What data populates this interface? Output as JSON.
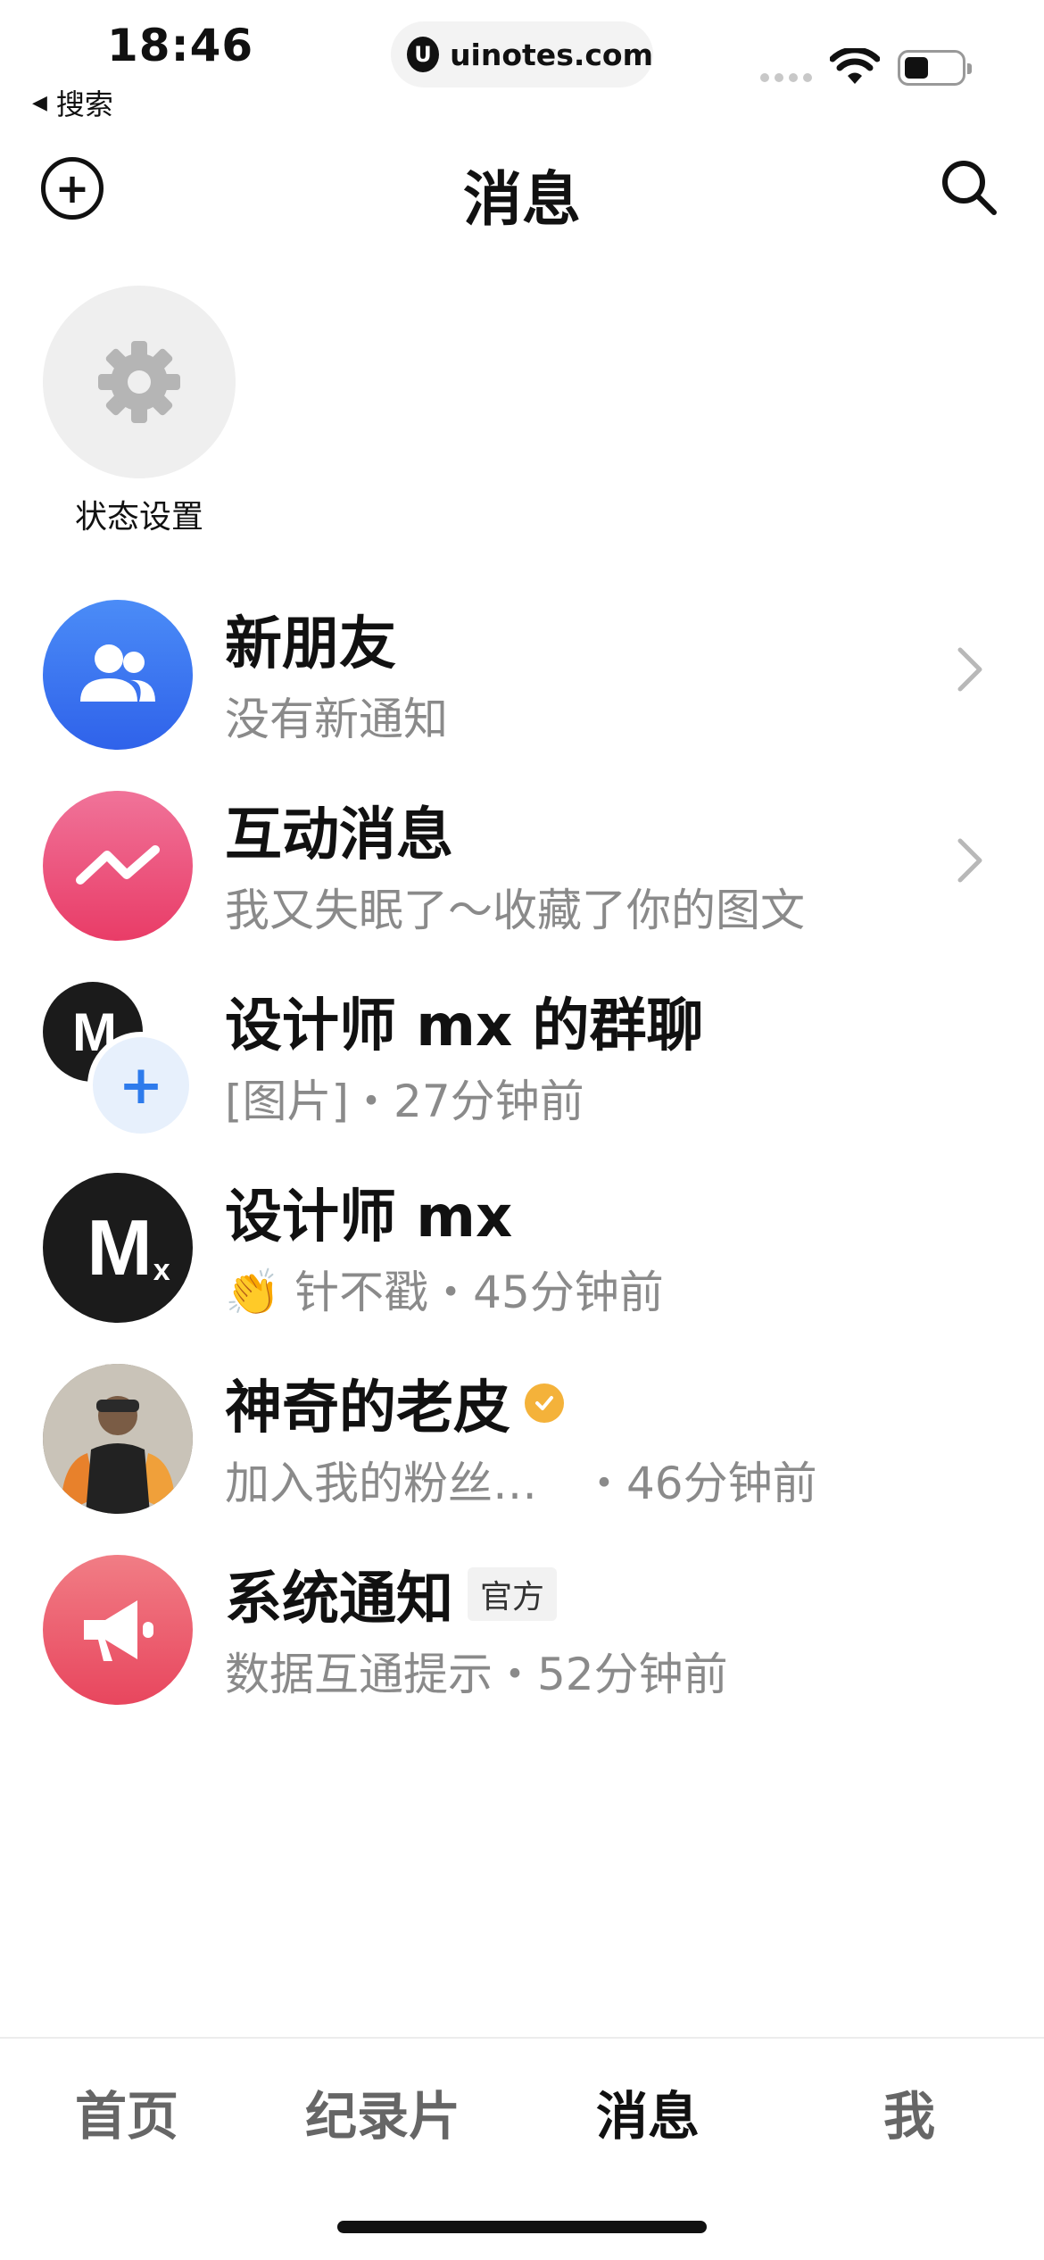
{
  "status_bar": {
    "time": "18:46",
    "back_app": "搜索",
    "url": "uinotes.com",
    "url_logo_letter": "U"
  },
  "header": {
    "title": "消息",
    "add_icon": "plus-circle-icon",
    "search_icon": "search-icon"
  },
  "status_setting": {
    "label": "状态设置",
    "icon": "gear-icon"
  },
  "messages": [
    {
      "title": "新朋友",
      "subtitle": "没有新通知",
      "avatar_icon": "friends-icon",
      "avatar_color": "#3a78f0",
      "has_chevron": true
    },
    {
      "title": "互动消息",
      "subtitle": "我又失眠了～收藏了你的图文",
      "avatar_icon": "zigzag-icon",
      "avatar_color": "#ec4b76",
      "has_chevron": true
    },
    {
      "title": "设计师 mx 的群聊",
      "subtitle": "[图片]・27分钟前",
      "avatar_icon": "group-avatar",
      "avatar_letter": "M",
      "plus": "+"
    },
    {
      "title": "设计师 mx",
      "subtitle": "👏 针不戳・45分钟前",
      "avatar_letter": "M",
      "avatar_sub": "x",
      "avatar_color": "#1b1b1b"
    },
    {
      "title": "神奇的老皮",
      "subtitle": "加入我的粉丝…　・46分钟前",
      "avatar_icon": "user-photo",
      "verified_icon": "verified-check-icon"
    },
    {
      "title": "系统通知",
      "badge": "官方",
      "subtitle": "数据互通提示・52分钟前",
      "avatar_icon": "megaphone-icon",
      "avatar_color": "#ec5a6e"
    }
  ],
  "tabbar": {
    "tabs": [
      "首页",
      "纪录片",
      "消息",
      "我"
    ],
    "active_index": 2
  }
}
